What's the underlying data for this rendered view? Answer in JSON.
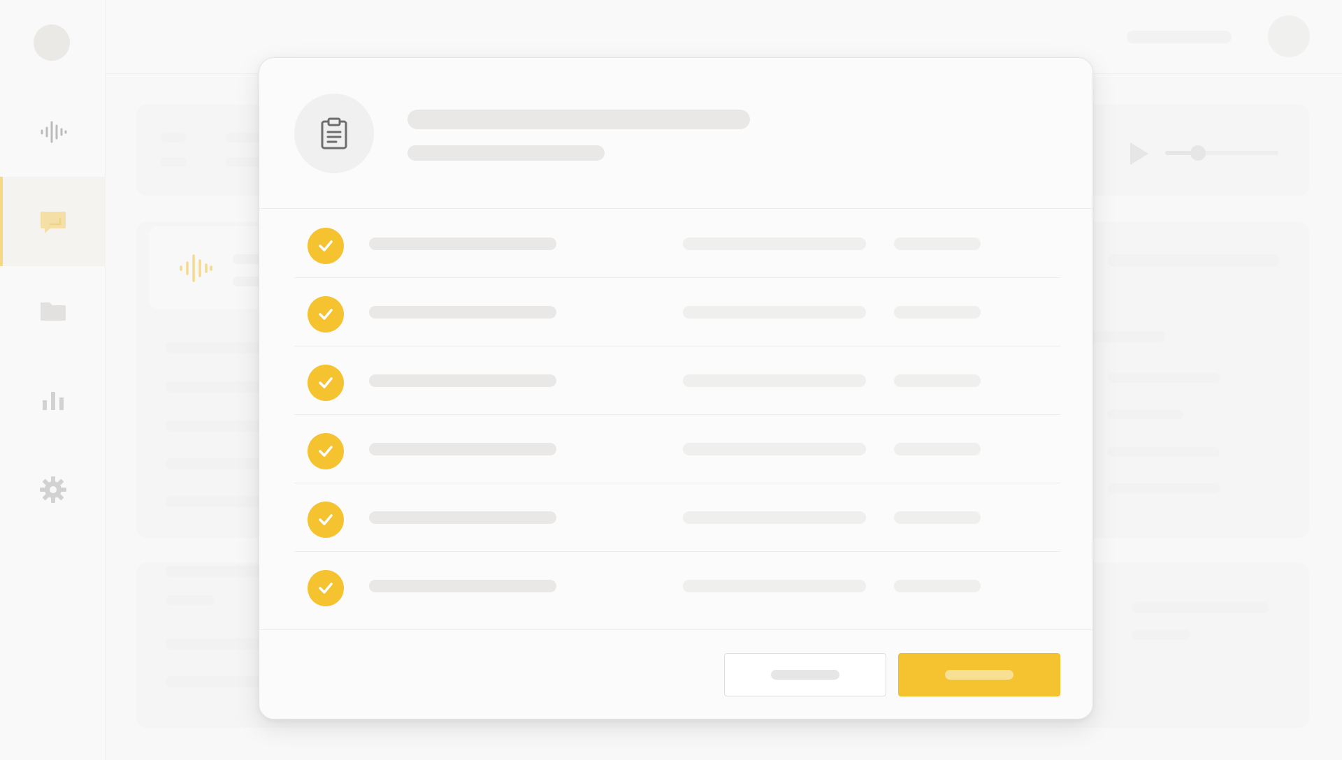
{
  "theme": {
    "accent": "#f5c230",
    "background": "#f7f7f7",
    "placeholder": "#e9e8e6"
  },
  "sidebar": {
    "items": [
      {
        "icon": "waveform-icon",
        "active": false
      },
      {
        "icon": "chat-icon",
        "active": true
      },
      {
        "icon": "folder-icon",
        "active": false
      },
      {
        "icon": "bar-chart-icon",
        "active": false
      },
      {
        "icon": "gear-icon",
        "active": false
      }
    ]
  },
  "background_panel": {
    "icons": [
      "play-icon",
      "slider-knob-icon",
      "waveform-icon"
    ]
  },
  "modal": {
    "header_icon": "clipboard-icon",
    "title": "",
    "subtitle": "",
    "rows": [
      {
        "status": "complete",
        "icon": "check-circle-icon"
      },
      {
        "status": "complete",
        "icon": "check-circle-icon"
      },
      {
        "status": "complete",
        "icon": "check-circle-icon"
      },
      {
        "status": "complete",
        "icon": "check-circle-icon"
      },
      {
        "status": "complete",
        "icon": "check-circle-icon"
      },
      {
        "status": "complete",
        "icon": "check-circle-icon"
      }
    ],
    "cancel_label": "",
    "confirm_label": ""
  }
}
